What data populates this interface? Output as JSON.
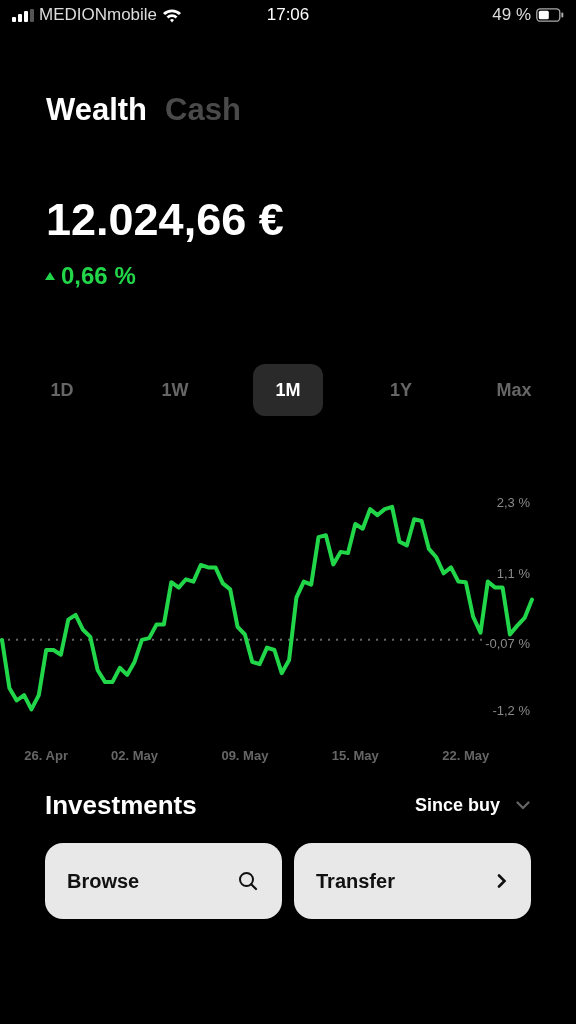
{
  "status_bar": {
    "carrier": "MEDIONmobile",
    "time": "17:06",
    "battery": "49 %"
  },
  "view_tabs": [
    {
      "label": "Wealth",
      "selected": true
    },
    {
      "label": "Cash",
      "selected": false
    }
  ],
  "balance": {
    "amount": "12.024,66 €",
    "change": "0,66 %"
  },
  "range_tabs": [
    {
      "label": "1D",
      "selected": false
    },
    {
      "label": "1W",
      "selected": false
    },
    {
      "label": "1M",
      "selected": true
    },
    {
      "label": "1Y",
      "selected": false
    },
    {
      "label": "Max",
      "selected": false
    }
  ],
  "chart": {
    "chart_data": {
      "type": "line",
      "ylim": [
        -1.2,
        2.3
      ],
      "categories": [
        null,
        null,
        null,
        null,
        null,
        null,
        "26. Apr",
        null,
        null,
        null,
        null,
        null,
        null,
        null,
        null,
        null,
        null,
        null,
        "02. May",
        null,
        null,
        null,
        null,
        null,
        null,
        null,
        null,
        null,
        null,
        null,
        null,
        null,
        null,
        "09. May",
        null,
        null,
        null,
        null,
        null,
        null,
        null,
        null,
        null,
        null,
        null,
        null,
        null,
        null,
        "15. May",
        null,
        null,
        null,
        null,
        null,
        null,
        null,
        null,
        null,
        null,
        null,
        null,
        null,
        null,
        "22. May",
        null,
        null,
        null,
        null,
        null,
        null,
        null,
        null,
        null
      ],
      "yticks": [
        {
          "value": 2.3,
          "label": "2,3 %"
        },
        {
          "value": 1.1,
          "label": "1,1 %"
        },
        {
          "value": -0.07,
          "label": "-0,07 %"
        },
        {
          "value": -1.2,
          "label": "-1,2 %"
        }
      ],
      "series": [
        {
          "color": "#22d64a",
          "values": [
            -0.02,
            -0.83,
            -1.04,
            -0.95,
            -1.19,
            -0.95,
            -0.19,
            -0.19,
            -0.27,
            0.32,
            0.4,
            0.15,
            0.03,
            -0.53,
            -0.73,
            -0.73,
            -0.49,
            -0.61,
            -0.39,
            -0.02,
            0.01,
            0.24,
            0.24,
            0.95,
            0.86,
            1.0,
            0.96,
            1.24,
            1.2,
            1.2,
            0.93,
            0.83,
            0.2,
            0.07,
            -0.39,
            -0.43,
            -0.15,
            -0.19,
            -0.58,
            -0.36,
            0.69,
            0.96,
            0.91,
            1.71,
            1.74,
            1.25,
            1.46,
            1.44,
            1.93,
            1.85,
            2.18,
            2.08,
            2.18,
            2.22,
            1.63,
            1.57,
            2.01,
            1.98,
            1.51,
            1.37,
            1.1,
            1.2,
            0.96,
            0.95,
            0.37,
            0.1,
            0.96,
            0.86,
            0.86,
            0.07,
            0.22,
            0.35,
            0.66
          ]
        }
      ]
    }
  },
  "investments": {
    "title": "Investments",
    "filter": "Since buy"
  },
  "actions": [
    {
      "label": "Browse",
      "kind": "search"
    },
    {
      "label": "Transfer",
      "kind": "next"
    }
  ]
}
